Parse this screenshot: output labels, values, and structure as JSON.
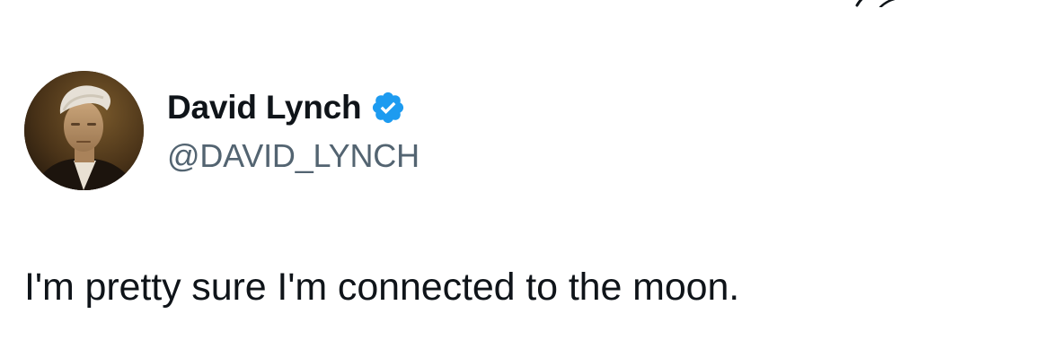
{
  "author": {
    "display_name": "David Lynch",
    "handle": "@DAVID_LYNCH",
    "verified": true,
    "verified_badge_color": "#1d9bf0"
  },
  "tweet": {
    "text": "I'm pretty sure I'm connected to the moon."
  },
  "icons": {
    "avatar": "profile-photo",
    "badge": "verified-check-icon"
  }
}
